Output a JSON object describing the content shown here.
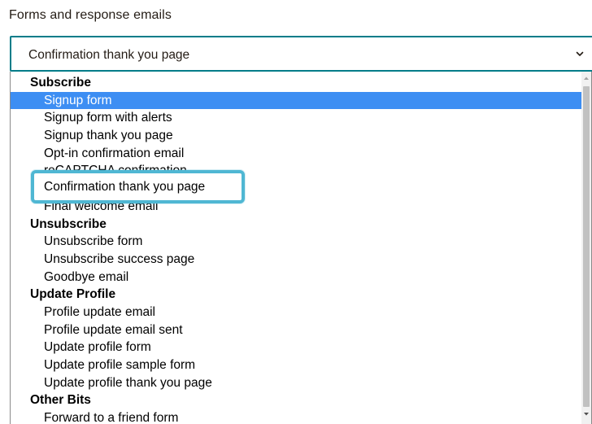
{
  "field_label": "Forms and response emails",
  "select": {
    "value": "Confirmation thank you page",
    "chevron_icon": "chevron-down-icon"
  },
  "dropdown": {
    "groups": [
      {
        "label": "Subscribe",
        "options": [
          "Signup form",
          "Signup form with alerts",
          "Signup thank you page",
          "Opt-in confirmation email",
          "reCAPTCHA confirmation",
          "Confirmation thank you page",
          "Final welcome email"
        ]
      },
      {
        "label": "Unsubscribe",
        "options": [
          "Unsubscribe form",
          "Unsubscribe success page",
          "Goodbye email"
        ]
      },
      {
        "label": "Update Profile",
        "options": [
          "Profile update email",
          "Profile update email sent",
          "Update profile form",
          "Update profile sample form",
          "Update profile thank you page"
        ]
      },
      {
        "label": "Other Bits",
        "options": [
          "Forward to a friend form"
        ]
      }
    ],
    "highlighted_option": "Signup form",
    "highlight_color": "#3d8ef3"
  },
  "callout": {
    "text": "Confirmation thank you page",
    "border_color": "#4fb7d3"
  },
  "colors": {
    "select_border": "#007c89",
    "text": "#241c15"
  }
}
